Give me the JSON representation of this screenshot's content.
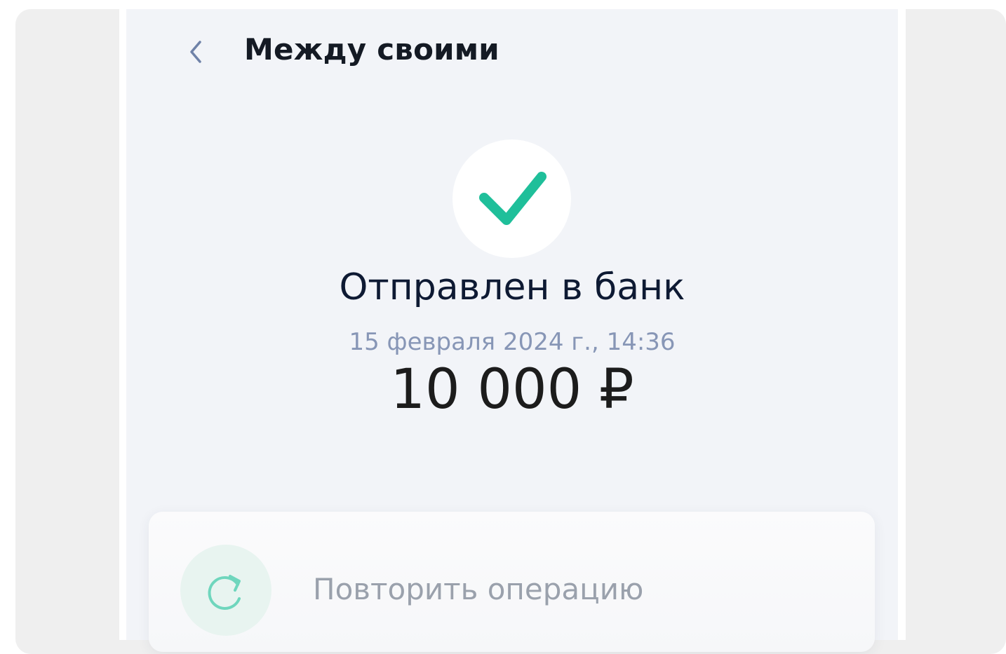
{
  "header": {
    "title": "Между своими",
    "back_icon": "chevron-left-icon"
  },
  "status": {
    "icon": "check-icon",
    "title": "Отправлен в банк",
    "date": "15 февраля 2024 г., 14:36",
    "amount": "10 000 ₽"
  },
  "actions": {
    "repeat": {
      "icon": "repeat-icon",
      "label": "Повторить операцию"
    }
  },
  "colors": {
    "accent": "#1fbf9a",
    "back_chevron": "#6f82a8",
    "screen_bg": "#f2f4f8"
  }
}
